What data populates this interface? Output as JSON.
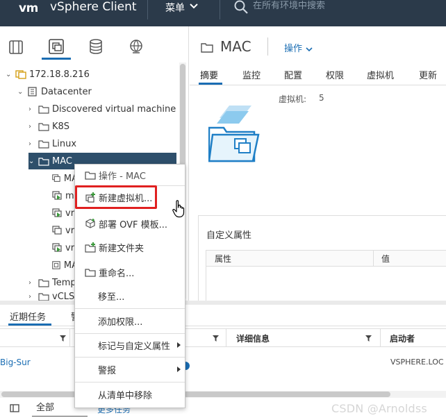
{
  "header": {
    "logo": "vm",
    "app_title": "vSphere Client",
    "menu_label": "菜单",
    "search_placeholder": "在所有环境中搜索"
  },
  "navigator": {
    "tabs": [
      "hosts-and-clusters-icon",
      "vms-and-templates-icon",
      "storage-icon",
      "networking-icon"
    ],
    "active_tab": 1,
    "tree": [
      {
        "label": "172.18.8.216",
        "icon": "vcenter-icon",
        "level": 0,
        "expanded": true
      },
      {
        "label": "Datacenter",
        "icon": "datacenter-icon",
        "level": 1,
        "expanded": true
      },
      {
        "label": "Discovered virtual machine",
        "icon": "folder-icon",
        "level": 2,
        "expanded": false
      },
      {
        "label": "K8S",
        "icon": "folder-icon",
        "level": 2,
        "expanded": false
      },
      {
        "label": "Linux",
        "icon": "folder-icon",
        "level": 2,
        "expanded": false
      },
      {
        "label": "MAC",
        "icon": "folder-icon",
        "level": 2,
        "expanded": true,
        "selected": true
      },
      {
        "label": "MA",
        "icon": "vm-icon",
        "level": 3
      },
      {
        "label": "m",
        "icon": "vm-running-icon",
        "level": 3
      },
      {
        "label": "vr",
        "icon": "vm-running-icon",
        "level": 3
      },
      {
        "label": "vr",
        "icon": "vm-icon",
        "level": 3
      },
      {
        "label": "vr",
        "icon": "vm-running-icon",
        "level": 3
      },
      {
        "label": "MA",
        "icon": "template-icon",
        "level": 3
      },
      {
        "label": "Temp",
        "icon": "folder-icon",
        "level": 2,
        "expanded": false
      },
      {
        "label": "vCLS",
        "icon": "folder-icon",
        "level": 2,
        "expanded": false
      }
    ]
  },
  "main": {
    "object_title": "MAC",
    "actions_label": "操作",
    "tabs": [
      "摘要",
      "监控",
      "配置",
      "权限",
      "虚拟机",
      "更新"
    ],
    "active_tab": 0,
    "vm_count_label": "虚拟机:",
    "vm_count_value": "5",
    "custom_attributes": {
      "title": "自定义属性",
      "col_attribute": "属性",
      "col_value": "值"
    }
  },
  "tasks": {
    "tab_recent": "近期任务",
    "tab_alarms": "警",
    "col_details": "详细信息",
    "col_initiator": "启动者",
    "row_target": "Big-Sur",
    "row_initiator": "VSPHERE.LOC",
    "footer_filter": "全部",
    "footer_more": "更多任务"
  },
  "context_menu": {
    "header": "操作 - MAC",
    "items": [
      {
        "label": "新建虚拟机...",
        "icon": "new-vm-icon",
        "highlighted": true
      },
      {
        "label": "部署 OVF 模板...",
        "icon": "deploy-ovf-icon"
      },
      {
        "label": "新建文件夹",
        "icon": "new-folder-icon"
      },
      {
        "label": "重命名...",
        "icon": "rename-folder-icon"
      },
      {
        "label": "移至...",
        "icon": ""
      },
      {
        "label": "添加权限...",
        "icon": ""
      },
      {
        "label": "标记与自定义属性",
        "icon": "",
        "submenu": true
      },
      {
        "label": "警报",
        "icon": "",
        "submenu": true
      },
      {
        "label": "从清单中移除",
        "icon": ""
      }
    ]
  },
  "watermark": "CSDN @Arnoldss",
  "colors": {
    "header_bg": "#2b3a4a",
    "accent": "#1a6db3",
    "selected_row": "#2e4f6b",
    "highlight_red": "#e02020"
  }
}
